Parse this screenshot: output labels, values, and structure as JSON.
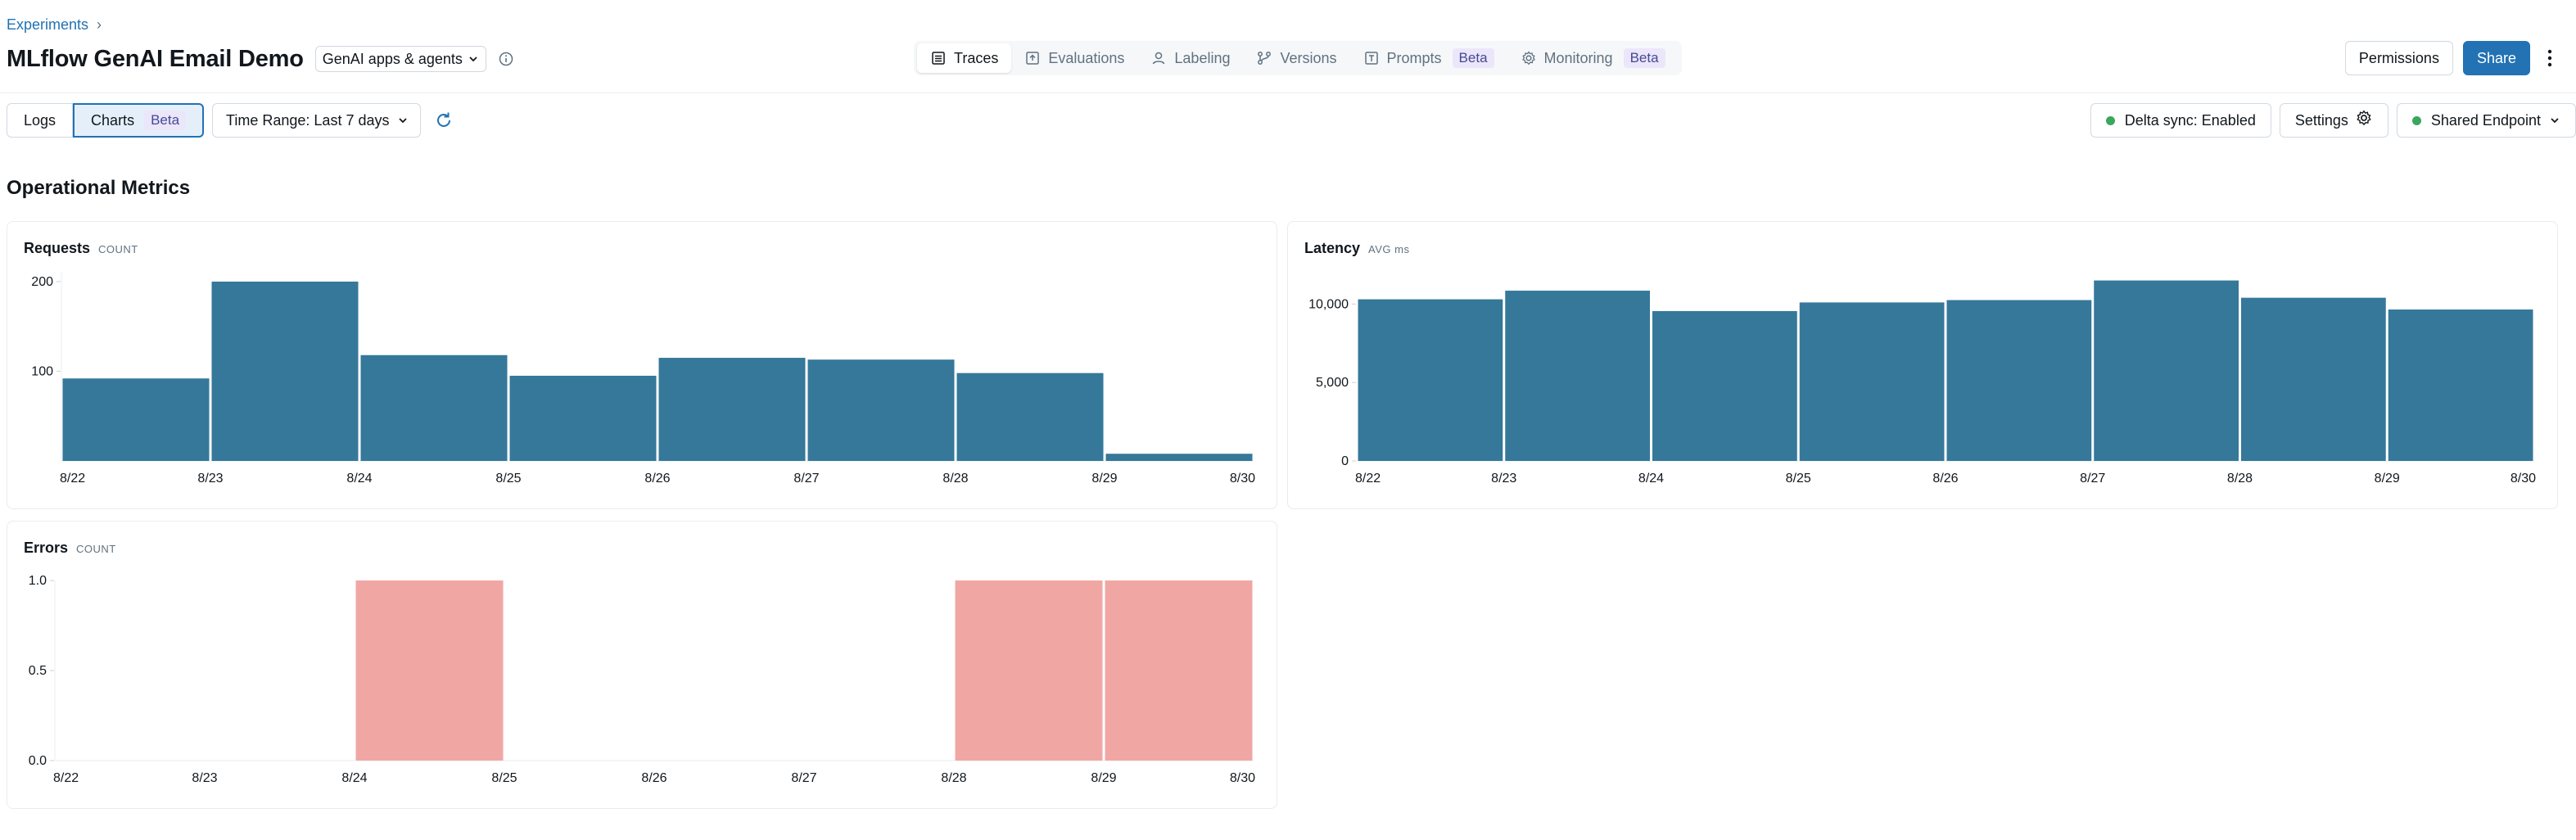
{
  "breadcrumb": {
    "parent": "Experiments",
    "separator": "›"
  },
  "header": {
    "title": "MLflow GenAI Email Demo",
    "type_select": "GenAI apps & agents"
  },
  "tabs": [
    {
      "label": "Traces",
      "icon": "list-icon"
    },
    {
      "label": "Evaluations",
      "icon": "upload-box-icon"
    },
    {
      "label": "Labeling",
      "icon": "user-icon"
    },
    {
      "label": "Versions",
      "icon": "branch-icon"
    },
    {
      "label": "Prompts",
      "icon": "text-box-icon",
      "badge": "Beta"
    },
    {
      "label": "Monitoring",
      "icon": "gear-icon",
      "badge": "Beta"
    }
  ],
  "actions": {
    "permissions": "Permissions",
    "share": "Share"
  },
  "toolbar": {
    "logs": "Logs",
    "charts": "Charts",
    "charts_badge": "Beta",
    "time_range": "Time Range: Last 7 days",
    "delta_sync": "Delta sync: Enabled",
    "settings": "Settings",
    "endpoint": "Shared Endpoint"
  },
  "colors": {
    "accent": "#2272b4",
    "bar_primary": "#35789a",
    "bar_error": "#f0a7a4",
    "status_green": "#3ba65e"
  },
  "section_title": "Operational Metrics",
  "chart_data": [
    {
      "type": "bar",
      "title": "Requests",
      "subtitle": "COUNT",
      "x_ticks": [
        "8/22",
        "8/23",
        "8/24",
        "8/25",
        "8/26",
        "8/27",
        "8/28",
        "8/29",
        "8/30"
      ],
      "categories": [
        "8/22",
        "8/23",
        "8/24",
        "8/25",
        "8/26",
        "8/27",
        "8/28",
        "8/29"
      ],
      "values": [
        92,
        200,
        118,
        95,
        115,
        113,
        98,
        8
      ],
      "y_ticks": [
        100,
        200
      ],
      "ylim": [
        0,
        210
      ]
    },
    {
      "type": "bar",
      "title": "Latency",
      "subtitle": "AVG ms",
      "x_ticks": [
        "8/22",
        "8/23",
        "8/24",
        "8/25",
        "8/26",
        "8/27",
        "8/28",
        "8/29",
        "8/30"
      ],
      "categories": [
        "8/22",
        "8/23",
        "8/24",
        "8/25",
        "8/26",
        "8/27",
        "8/28",
        "8/29"
      ],
      "values": [
        10300,
        10850,
        9550,
        10100,
        10250,
        11500,
        10400,
        9650
      ],
      "y_ticks": [
        0,
        5000,
        10000
      ],
      "y_tick_labels": [
        "0",
        "5,000",
        "10,000"
      ],
      "ylim": [
        0,
        12000
      ]
    },
    {
      "type": "bar",
      "title": "Errors",
      "subtitle": "COUNT",
      "x_ticks": [
        "8/22",
        "8/23",
        "8/24",
        "8/25",
        "8/26",
        "8/27",
        "8/28",
        "8/29",
        "8/30"
      ],
      "categories": [
        "8/22",
        "8/23",
        "8/24",
        "8/25",
        "8/26",
        "8/27",
        "8/28",
        "8/29"
      ],
      "values": [
        0,
        0,
        1,
        0,
        0,
        0,
        1,
        1
      ],
      "y_ticks": [
        0,
        0.5,
        1
      ],
      "y_tick_labels": [
        "0.0",
        "0.5",
        "1.0"
      ],
      "ylim": [
        0,
        1
      ]
    }
  ]
}
